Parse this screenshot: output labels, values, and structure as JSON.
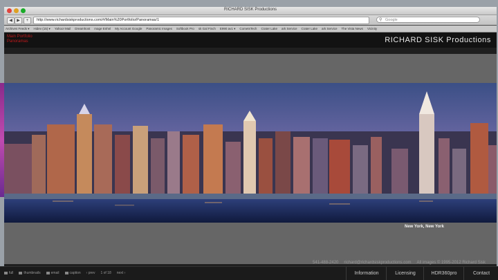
{
  "browser": {
    "window_title": "RICHARD SISK Productions",
    "url": "http://www.richardsiskproductions.com/#/Main%20Portfolio/Panoramas/1",
    "search_placeholder": "Google",
    "bookmarks": [
      "Archives Feeds ▾",
      "Hidev (15) ▾",
      "Yahoo! Mail",
      "Dreamhost",
      "mage Enhnl",
      "My Account Google",
      "Panoramic Images",
      "Softbook Pro",
      "sk Gal Finch",
      "E990 av1 ▾",
      "CometsTech",
      "Crater Lake",
      "ark Service",
      "Crater Lake",
      "ark Service",
      "The Vista News",
      "Vicinity"
    ]
  },
  "site": {
    "menu_items": [
      "Main Portfolio",
      "Panoramas"
    ],
    "brand": "RICHARD SISK Productions",
    "caption": "New York, New York",
    "phone": "541-488-2420",
    "email": "richard@richardsiskproductions.com",
    "copyright": "All images © 1995-2012 Richard Sisk"
  },
  "controls": {
    "full": "full",
    "thumbnails": "thumbnails",
    "email": "email",
    "caption": "caption",
    "prev": "‹ prev",
    "counter": "1 of 18",
    "next": "next ›"
  },
  "nav": {
    "information": "Information",
    "licensing": "Licensing",
    "hdr": "HDR360pro",
    "contact": "Contact"
  },
  "colors": {
    "accent_red": "#c0191b",
    "header_bg": "#121212",
    "gray_band": "#666666"
  }
}
